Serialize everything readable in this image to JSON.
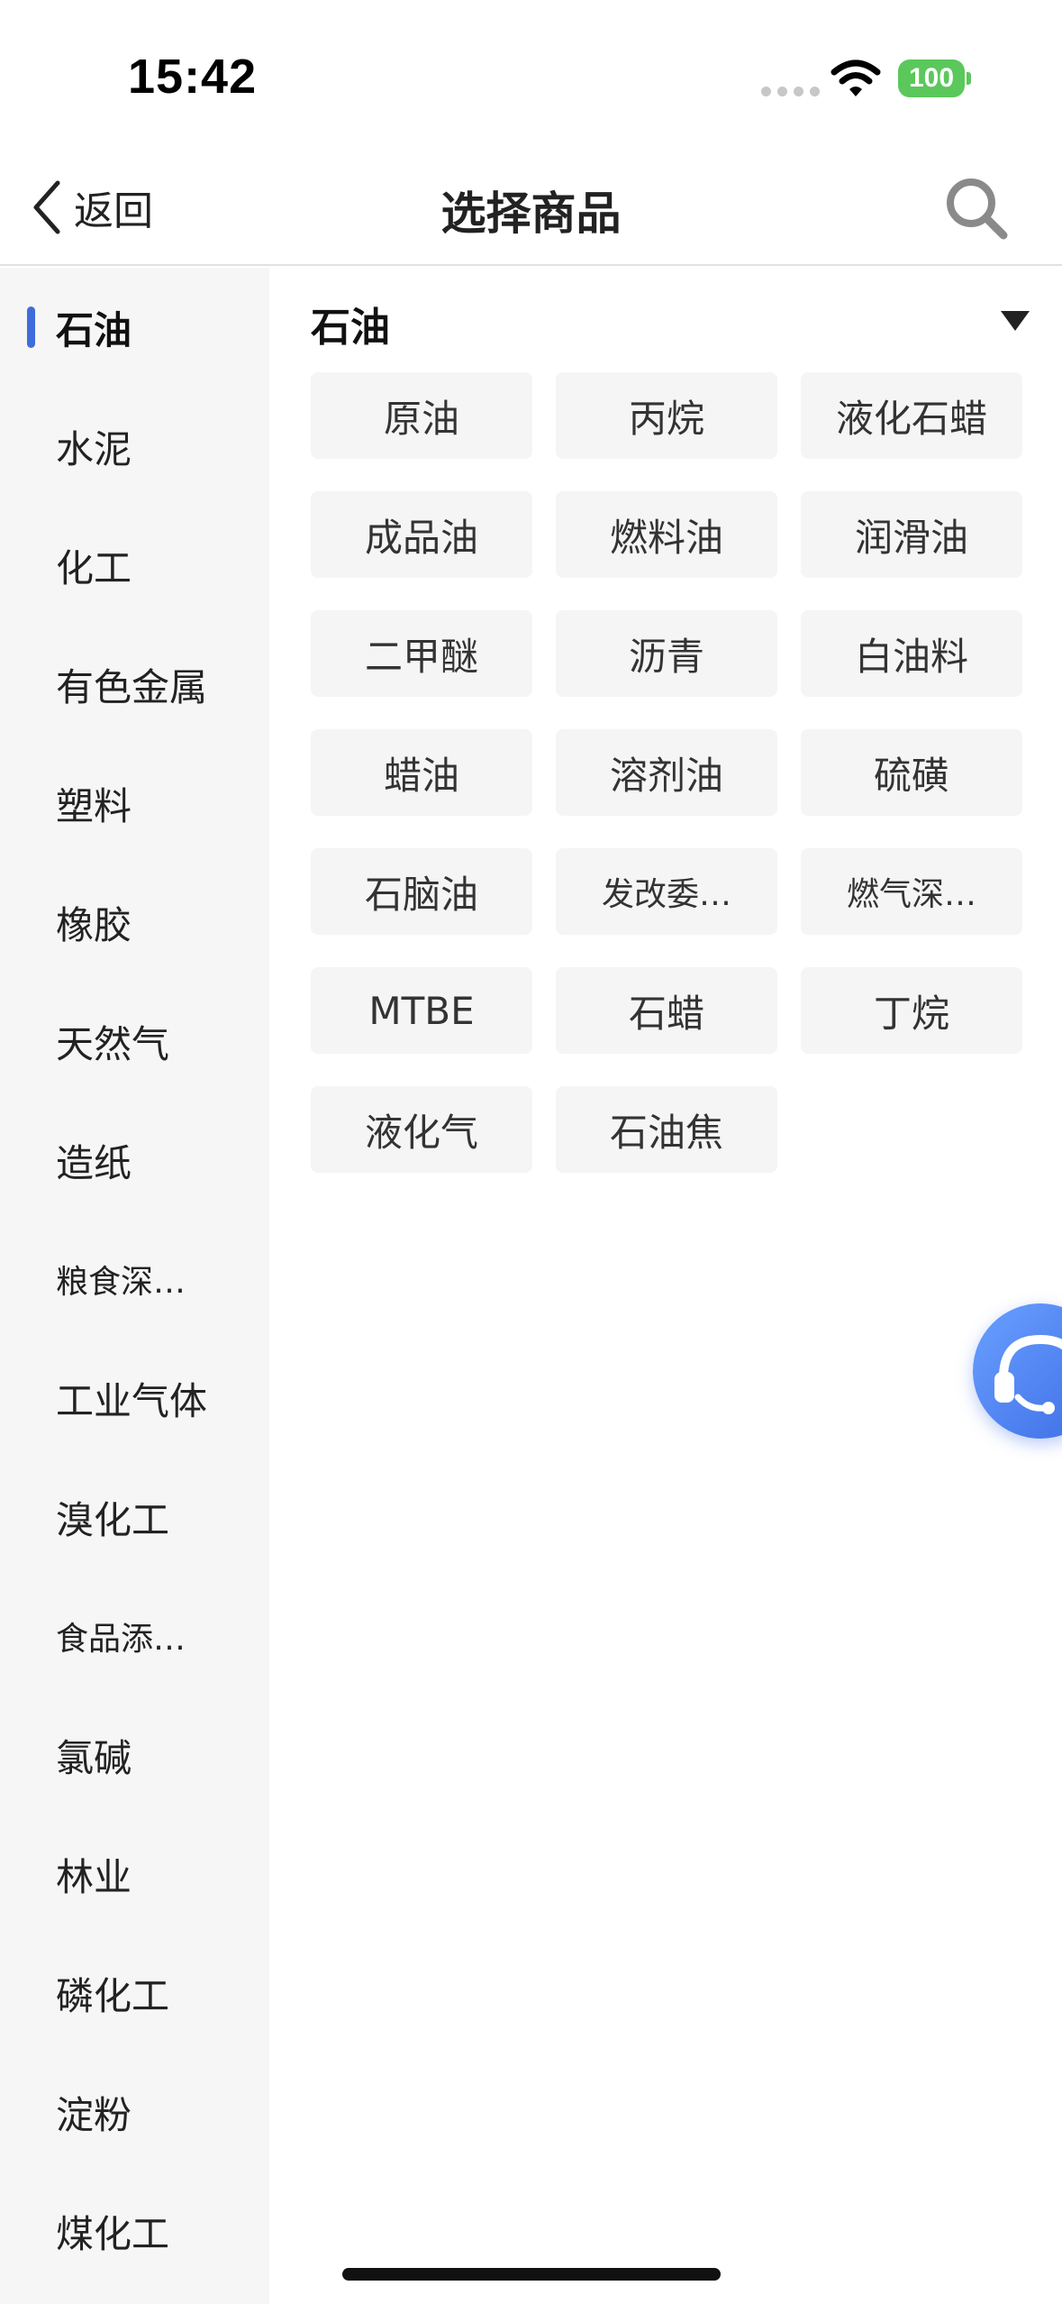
{
  "status_bar": {
    "time": "15:42",
    "battery": "100"
  },
  "nav": {
    "back_label": "返回",
    "title": "选择商品"
  },
  "sidebar": {
    "items": [
      {
        "label": "石油",
        "active": true
      },
      {
        "label": "水泥"
      },
      {
        "label": "化工"
      },
      {
        "label": "有色金属"
      },
      {
        "label": "塑料"
      },
      {
        "label": "橡胶"
      },
      {
        "label": "天然气"
      },
      {
        "label": "造纸"
      },
      {
        "label": "粮食深…"
      },
      {
        "label": "工业气体"
      },
      {
        "label": "溴化工"
      },
      {
        "label": "食品添…"
      },
      {
        "label": "氯碱"
      },
      {
        "label": "林业"
      },
      {
        "label": "磷化工"
      },
      {
        "label": "淀粉"
      },
      {
        "label": "煤化工"
      }
    ]
  },
  "section": {
    "title": "石油",
    "products": [
      "原油",
      "丙烷",
      "液化石蜡",
      "成品油",
      "燃料油",
      "润滑油",
      "二甲醚",
      "沥青",
      "白油料",
      "蜡油",
      "溶剂油",
      "硫磺",
      "石脑油",
      "发改委…",
      "燃气深…",
      "MTBE",
      "石蜡",
      "丁烷",
      "液化气",
      "石油焦"
    ]
  },
  "colors": {
    "accent": "#3e6ddb",
    "battery": "#5ac85a",
    "sidebar_bg": "#f6f6f6",
    "chip_bg": "#f5f5f5"
  }
}
